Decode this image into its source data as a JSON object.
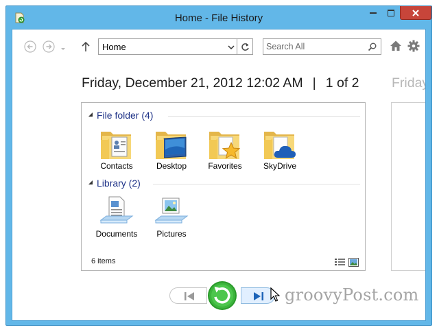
{
  "window": {
    "title": "Home - File History",
    "accent_color": "#62b7e8",
    "close_color": "#c7453a"
  },
  "icons": {
    "app": "file-history-icon",
    "minimize": "minimize-icon",
    "maximize": "maximize-icon",
    "close": "close-icon",
    "back": "back-arrow-icon",
    "forward": "forward-arrow-icon",
    "recent": "chevron-down-icon",
    "up": "up-arrow-icon",
    "refresh": "refresh-icon",
    "search": "search-icon",
    "home": "home-icon",
    "settings": "gear-icon",
    "previous": "previous-version-icon",
    "restore": "restore-icon",
    "next": "next-version-icon"
  },
  "address": {
    "value": "Home"
  },
  "search": {
    "placeholder": "Search All"
  },
  "snapshot": {
    "date": "Friday, December 21, 2012 12:02 AM",
    "separator": "|",
    "position": "1 of 2",
    "next_date_peek": "Friday,"
  },
  "groups": {
    "folders": {
      "label": "File folder (4)",
      "items": [
        {
          "label": "Contacts",
          "icon": "contacts-folder-icon"
        },
        {
          "label": "Desktop",
          "icon": "desktop-folder-icon"
        },
        {
          "label": "Favorites",
          "icon": "favorites-folder-icon"
        },
        {
          "label": "SkyDrive",
          "icon": "skydrive-folder-icon"
        }
      ]
    },
    "libraries": {
      "label": "Library (2)",
      "items": [
        {
          "label": "Documents",
          "icon": "documents-library-icon"
        },
        {
          "label": "Pictures",
          "icon": "pictures-library-icon"
        }
      ]
    }
  },
  "status": {
    "items_count": "6 items"
  },
  "watermark": "groovyPost.com"
}
